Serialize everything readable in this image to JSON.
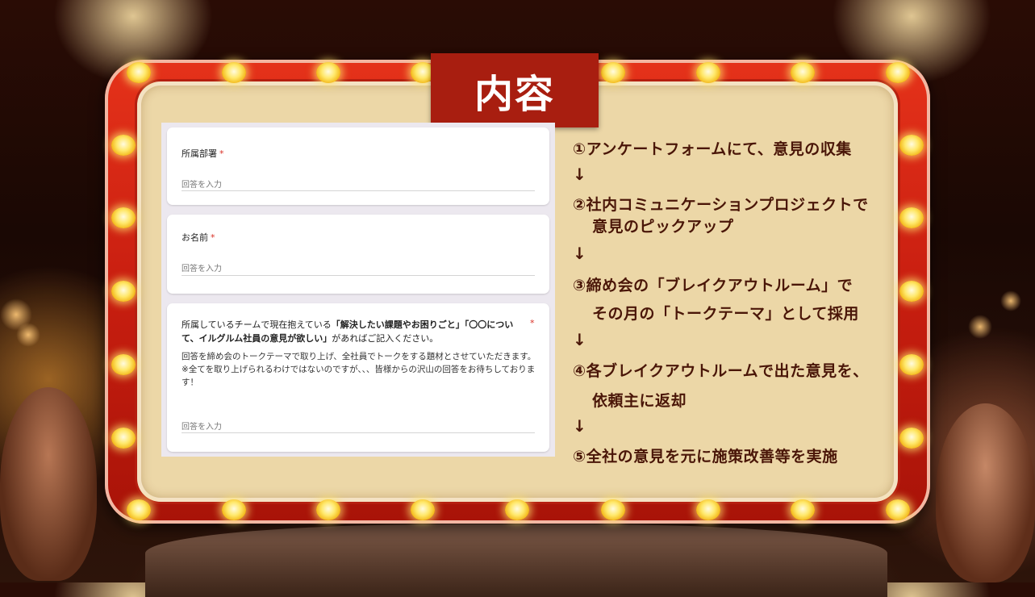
{
  "title": "内容",
  "form": {
    "answer_placeholder": "回答を入力",
    "required_mark": "*",
    "questions": [
      {
        "label": "所属部署"
      },
      {
        "label": "お名前"
      },
      {
        "label_prefix": "所属しているチームで現在抱えている",
        "label_bold1": "「解決したい課題やお困りごと」「〇〇について、イルグルム社員の意見が欲しい」",
        "label_suffix": "があればご記入ください。",
        "description_line1": "回答を締め会のトークテーマで取り上げ、全社員でトークをする題材とさせていただきます。",
        "description_line2": "※全てを取り上げられるわけではないのですが、、、皆様からの沢山の回答をお待ちしております！"
      }
    ]
  },
  "steps": {
    "step1": "①アンケートフォームにて、意見の収集",
    "arrow": "↓",
    "step2_line1": "②社内コミュニケーションプロジェクトで",
    "step2_line2": "意見のピックアップ",
    "step3_line1": "③締め会の「ブレイクアウトルーム」で",
    "step3_line2": "その月の「トークテーマ」として採用",
    "step4_line1": "④各ブレイクアウトルームで出た意見を、",
    "step4_line2": "依頼主に返却",
    "step5": "⑤全社の意見を元に施策改善等を実施"
  },
  "colors": {
    "frame_red": "#c81e10",
    "panel_beige": "#ecd7a7",
    "step_text": "#4a1608",
    "bulb_yellow": "#ffe86a"
  }
}
